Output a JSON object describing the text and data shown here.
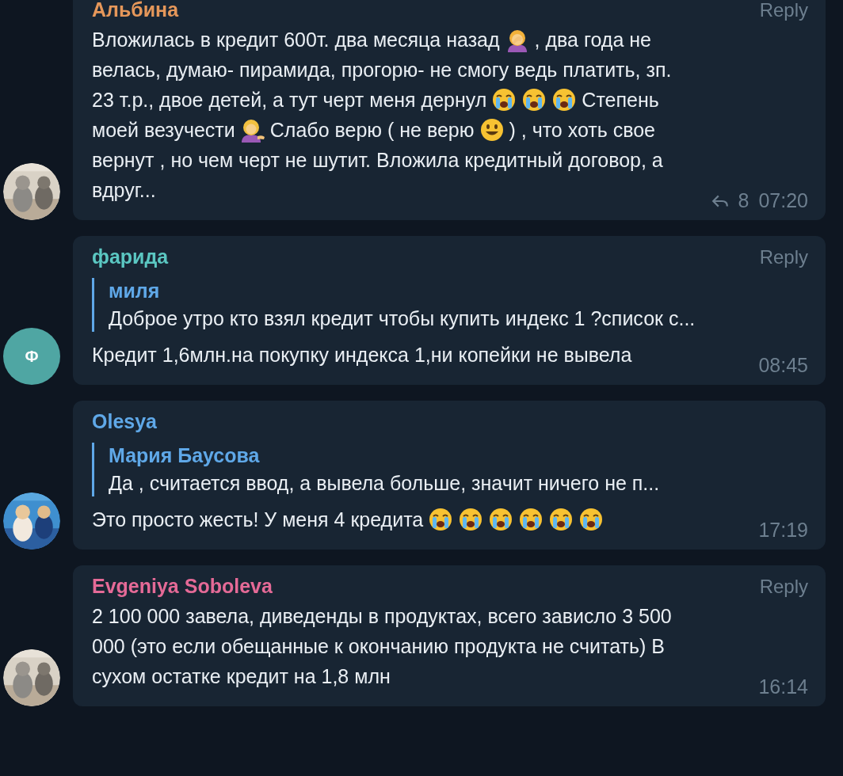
{
  "messages": [
    {
      "author": "Альбина",
      "color": "#e5975a",
      "avatar": {
        "kind": "picture"
      },
      "reply_label": "Reply",
      "lines": [
        [
          {
            "kind": "text",
            "text": "Вложилась в кредит 600т. два месяца назад"
          },
          {
            "kind": "facepalm"
          },
          {
            "kind": "text",
            "text": ", два года не"
          }
        ],
        [
          {
            "kind": "text",
            "text": "велась, думаю- пирамида, прогорю- не смогу ведь платить, зп."
          }
        ],
        [
          {
            "kind": "text",
            "text": "23 т.р., двое детей, а тут черт меня дернул"
          },
          {
            "kind": "crying"
          },
          {
            "kind": "crying"
          },
          {
            "kind": "crying"
          },
          {
            "kind": "text",
            "text": "Степень"
          }
        ],
        [
          {
            "kind": "text",
            "text": "моей везучести"
          },
          {
            "kind": "tipping"
          },
          {
            "kind": "text",
            "text": "Слабо верю ( не верю"
          },
          {
            "kind": "smiling"
          },
          {
            "kind": "text",
            "text": ") , что хоть свое"
          }
        ],
        [
          {
            "kind": "text",
            "text": "вернут , но чем черт не шутит. Вложила кредитный договор, а"
          }
        ],
        [
          {
            "kind": "text",
            "text": "вдруг..."
          }
        ]
      ],
      "forwards": "8",
      "time": "07:20"
    },
    {
      "author": "фарида",
      "color": "#5bc7c2",
      "avatar": {
        "kind": "letter",
        "letter": "Ф",
        "color": "#4fa6a3"
      },
      "reply_label": "Reply",
      "quote": {
        "author": "миля",
        "text": "Доброе утро кто взял кредит чтобы купить индекс 1 ?список с..."
      },
      "lines": [
        [
          {
            "kind": "text",
            "text": "Кредит 1,6млн.на покупку индекса 1,ни копейки не вывела"
          }
        ]
      ],
      "time": "08:45"
    },
    {
      "author": "Olesya",
      "color": "#5fa8e8",
      "avatar": {
        "kind": "picture"
      },
      "quote": {
        "author": "Мария Баусова",
        "text": "Да , считается ввод, а вывела больше, значит ничего не п..."
      },
      "lines": [
        [
          {
            "kind": "text",
            "text": "Это просто жесть! У меня 4 кредита"
          },
          {
            "kind": "crying"
          },
          {
            "kind": "crying"
          },
          {
            "kind": "crying"
          },
          {
            "kind": "crying"
          },
          {
            "kind": "crying"
          },
          {
            "kind": "crying"
          }
        ]
      ],
      "time": "17:19"
    },
    {
      "author": "Evgeniya Soboleva",
      "color": "#e56a97",
      "avatar": {
        "kind": "picture"
      },
      "reply_label": "Reply",
      "lines": [
        [
          {
            "kind": "text",
            "text": "2 100 000 завела, диведенды в продуктах, всего зависло 3 500"
          }
        ],
        [
          {
            "kind": "text",
            "text": "000 (это если обещанные к окончанию продукта не считать) В"
          }
        ],
        [
          {
            "kind": "text",
            "text": "сухом остатке кредит на 1,8 млн"
          }
        ]
      ],
      "time": "16:14"
    }
  ]
}
